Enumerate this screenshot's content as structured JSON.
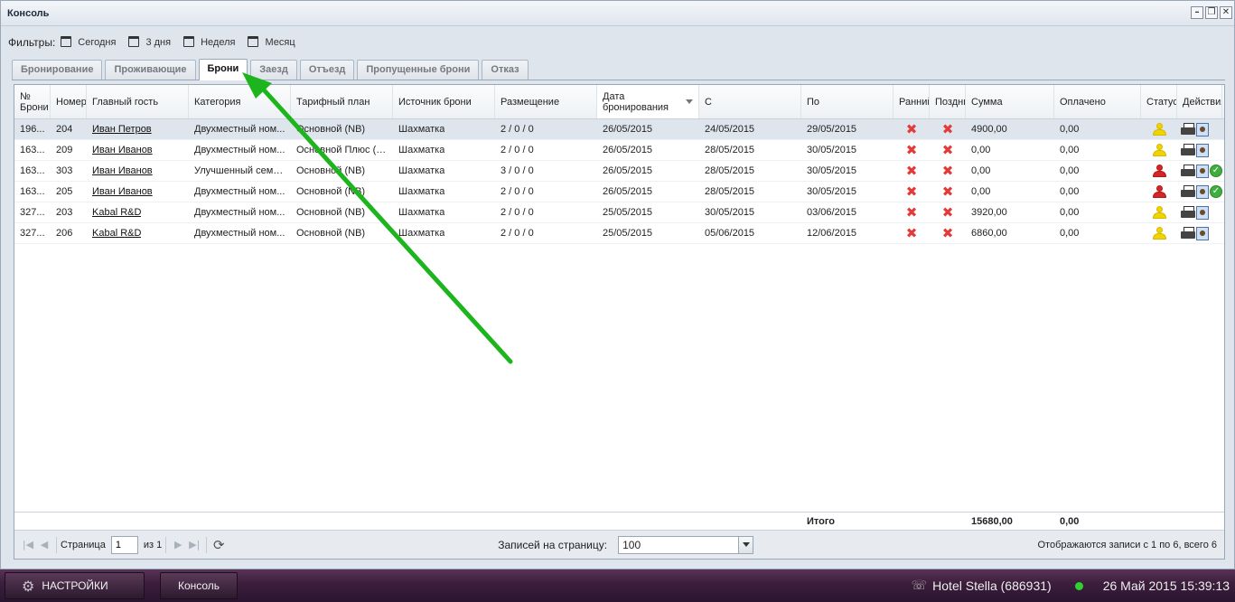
{
  "window": {
    "title": "Консоль"
  },
  "filters": {
    "label": "Фильтры:",
    "items": [
      "Сегодня",
      "3 дня",
      "Неделя",
      "Месяц"
    ]
  },
  "tabs": [
    "Бронирование",
    "Проживающие",
    "Брони",
    "Заезд",
    "Отъезд",
    "Пропущенные брони",
    "Отказ"
  ],
  "active_tab": "Брони",
  "columns": [
    "№ Брони",
    "Номер",
    "Главный гость",
    "Категория",
    "Тарифный план",
    "Источник брони",
    "Размещение",
    "Дата бронирования",
    "С",
    "По",
    "Ранний",
    "Поздний",
    "Сумма",
    "Оплачено",
    "Статус",
    "Действия"
  ],
  "rows": [
    {
      "id": "196...",
      "room": "204",
      "guest": "Иван Петров",
      "category": "Двухместный ном...",
      "rate": "Основной (NB)",
      "source": "Шахматка",
      "placement": "2 / 0 / 0",
      "booked": "26/05/2015",
      "from": "24/05/2015",
      "to": "29/05/2015",
      "sum": "4900,00",
      "paid": "0,00",
      "status_color": "yellow",
      "ok": false
    },
    {
      "id": "163...",
      "room": "209",
      "guest": "Иван Иванов",
      "category": "Двухместный ном...",
      "rate": "Основной Плюс (BB)",
      "source": "Шахматка",
      "placement": "2 / 0 / 0",
      "booked": "26/05/2015",
      "from": "28/05/2015",
      "to": "30/05/2015",
      "sum": "0,00",
      "paid": "0,00",
      "status_color": "yellow",
      "ok": false
    },
    {
      "id": "163...",
      "room": "303",
      "guest": "Иван Иванов",
      "category": "Улучшенный семе...",
      "rate": "Основной (NB)",
      "source": "Шахматка",
      "placement": "3 / 0 / 0",
      "booked": "26/05/2015",
      "from": "28/05/2015",
      "to": "30/05/2015",
      "sum": "0,00",
      "paid": "0,00",
      "status_color": "red",
      "ok": true
    },
    {
      "id": "163...",
      "room": "205",
      "guest": "Иван Иванов",
      "category": "Двухместный ном...",
      "rate": "Основной (NB)",
      "source": "Шахматка",
      "placement": "2 / 0 / 0",
      "booked": "26/05/2015",
      "from": "28/05/2015",
      "to": "30/05/2015",
      "sum": "0,00",
      "paid": "0,00",
      "status_color": "red",
      "ok": true
    },
    {
      "id": "327...",
      "room": "203",
      "guest": "Kabal R&D",
      "category": "Двухместный ном...",
      "rate": "Основной (NB)",
      "source": "Шахматка",
      "placement": "2 / 0 / 0",
      "booked": "25/05/2015",
      "from": "30/05/2015",
      "to": "03/06/2015",
      "sum": "3920,00",
      "paid": "0,00",
      "status_color": "yellow",
      "ok": false
    },
    {
      "id": "327...",
      "room": "206",
      "guest": "Kabal R&D",
      "category": "Двухместный ном...",
      "rate": "Основной (NB)",
      "source": "Шахматка",
      "placement": "2 / 0 / 0",
      "booked": "25/05/2015",
      "from": "05/06/2015",
      "to": "12/06/2015",
      "sum": "6860,00",
      "paid": "0,00",
      "status_color": "yellow",
      "ok": false
    }
  ],
  "totals": {
    "label": "Итого",
    "sum": "15680,00",
    "paid": "0,00"
  },
  "pager": {
    "page_label": "Страница",
    "page": "1",
    "of_label": "из 1",
    "per_page_label": "Записей на страницу:",
    "per_page": "100",
    "summary": "Отображаются записи с 1 по 6, всего 6"
  },
  "taskbar": {
    "settings": "НАСТРОЙКИ",
    "console": "Консоль",
    "hotel": "Hotel Stella (686931)",
    "datetime": "26 Май 2015 15:39:13"
  },
  "colors": {
    "accent_arrow": "#1db51d",
    "taskbar": "#3d1f3d"
  }
}
